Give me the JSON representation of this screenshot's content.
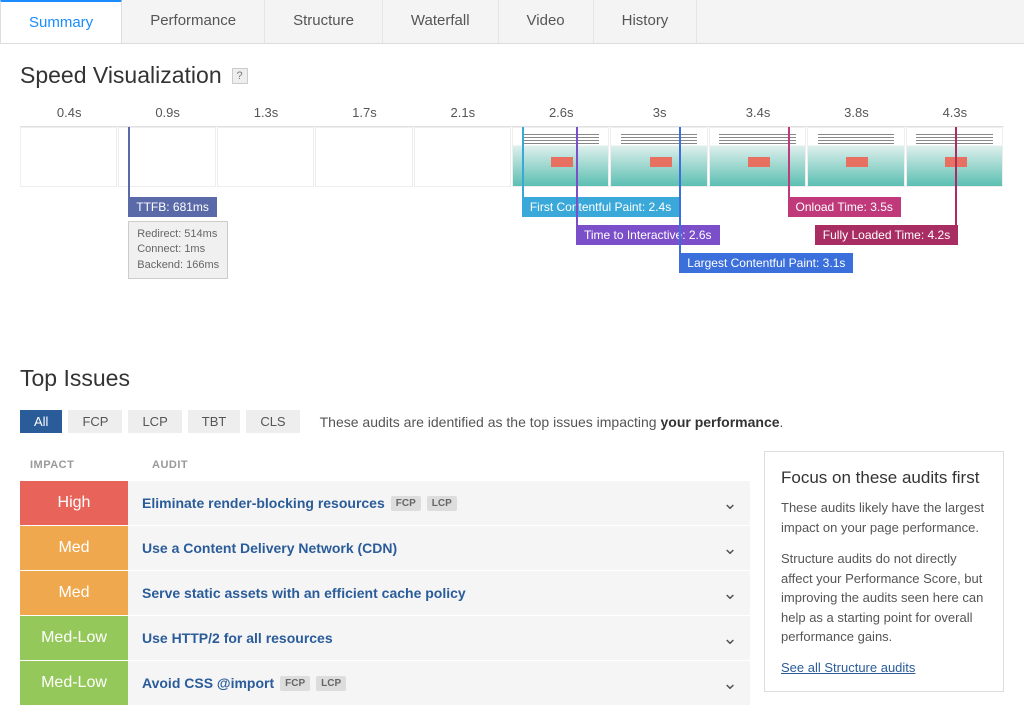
{
  "tabs": [
    "Summary",
    "Performance",
    "Structure",
    "Waterfall",
    "Video",
    "History"
  ],
  "active_tab": 0,
  "speed_viz": {
    "title": "Speed Visualization",
    "ticks": [
      "0.4s",
      "0.9s",
      "1.3s",
      "1.7s",
      "2.1s",
      "2.6s",
      "3s",
      "3.4s",
      "3.8s",
      "4.3s"
    ],
    "loaded_from_index": 5,
    "markers": {
      "ttfb": {
        "label": "TTFB: 681ms",
        "color": "#5a6aa8",
        "pos_pct": 11,
        "details": [
          "Redirect: 514ms",
          "Connect: 1ms",
          "Backend: 166ms"
        ]
      },
      "fcp": {
        "label": "First Contentful Paint: 2.4s",
        "color": "#3aa8d8",
        "pos_pct": 51
      },
      "tti": {
        "label": "Time to Interactive: 2.6s",
        "color": "#7a4fc9",
        "pos_pct": 56.5
      },
      "lcp": {
        "label": "Largest Contentful Paint: 3.1s",
        "color": "#3a6fdc",
        "pos_pct": 67
      },
      "onload": {
        "label": "Onload Time: 3.5s",
        "color": "#c0397a",
        "pos_pct": 78
      },
      "fully": {
        "label": "Fully Loaded Time: 4.2s",
        "color": "#a82d62",
        "pos_pct": 95
      }
    }
  },
  "top_issues": {
    "title": "Top Issues",
    "filters": [
      "All",
      "FCP",
      "LCP",
      "TBT",
      "CLS"
    ],
    "active_filter": 0,
    "desc_prefix": "These audits are identified as the top issues impacting ",
    "desc_bold": "your performance",
    "headers": {
      "impact": "IMPACT",
      "audit": "AUDIT"
    },
    "rows": [
      {
        "impact": "High",
        "audit": "Eliminate render-blocking resources",
        "tags": [
          "FCP",
          "LCP"
        ]
      },
      {
        "impact": "Med",
        "audit": "Use a Content Delivery Network (CDN)",
        "tags": []
      },
      {
        "impact": "Med",
        "audit": "Serve static assets with an efficient cache policy",
        "tags": []
      },
      {
        "impact": "Med-Low",
        "audit": "Use HTTP/2 for all resources",
        "tags": []
      },
      {
        "impact": "Med-Low",
        "audit": "Avoid CSS @import",
        "tags": [
          "FCP",
          "LCP"
        ]
      }
    ]
  },
  "side_panel": {
    "title": "Focus on these audits first",
    "p1": "These audits likely have the largest impact on your page performance.",
    "p2": "Structure audits do not directly affect your Performance Score, but improving the audits seen here can help as a starting point for overall performance gains.",
    "link": "See all Structure audits"
  }
}
